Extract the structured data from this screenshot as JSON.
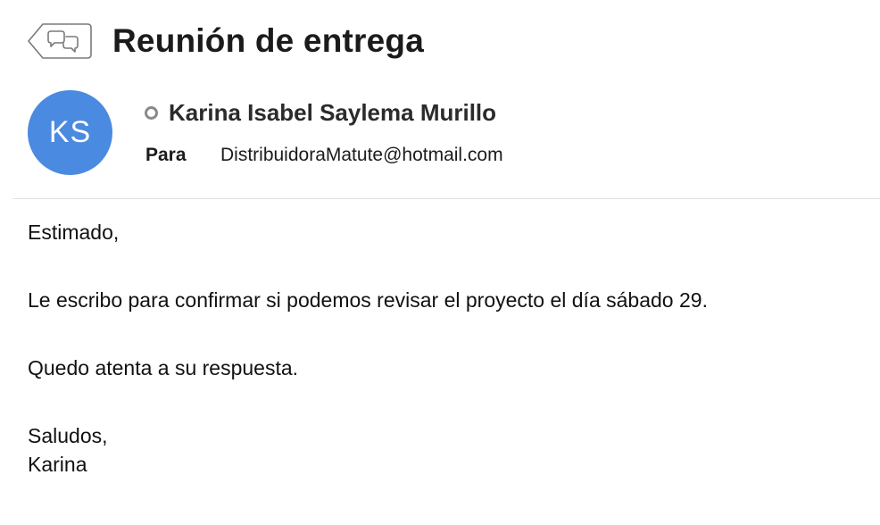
{
  "message": {
    "subject": "Reunión de entrega",
    "sender": {
      "initials": "KS",
      "name": "Karina Isabel Saylema Murillo",
      "avatar_color": "#4a8ae0"
    },
    "recipients": {
      "label": "Para",
      "address": "DistribuidoraMatute@hotmail.com"
    },
    "body": {
      "greeting": "Estimado,",
      "paragraph1": "Le escribo para confirmar si podemos revisar el proyecto el día sábado 29.",
      "paragraph2": "Quedo atenta a su respuesta.",
      "closing": "Saludos,",
      "signature": "Karina"
    }
  },
  "icons": {
    "conversation_button": "back-conversation-icon",
    "presence": "presence-status-icon"
  }
}
